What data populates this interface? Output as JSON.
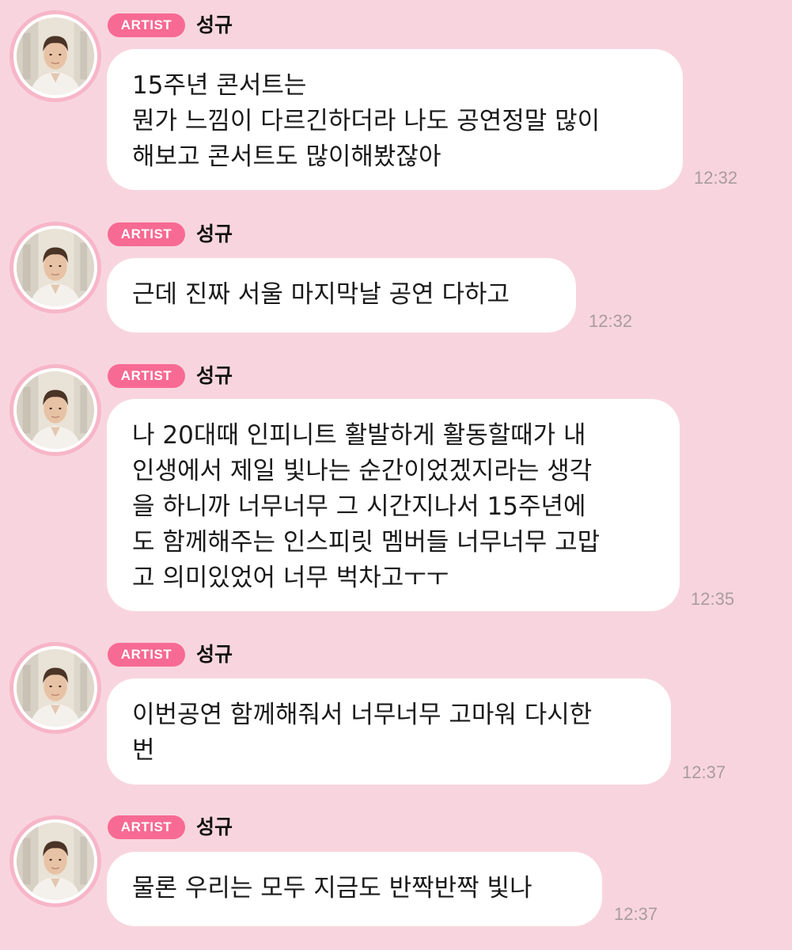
{
  "messages": [
    {
      "badge": "ARTIST",
      "sender": "성규",
      "text": "15주년 콘서트는\n뭔가 느낌이 다르긴하더라 나도 공연정말 많이\n해보고 콘서트도 많이해봤잖아",
      "time": "12:32"
    },
    {
      "badge": "ARTIST",
      "sender": "성규",
      "text": "근데 진짜 서울 마지막날 공연 다하고",
      "time": "12:32"
    },
    {
      "badge": "ARTIST",
      "sender": "성규",
      "text": "나 20대때 인피니트 활발하게 활동할때가 내\n인생에서 제일 빛나는 순간이었겠지라는 생각\n을 하니까 너무너무 그 시간지나서 15주년에\n도 함께해주는 인스피릿 멤버들 너무너무 고맙\n고 의미있었어 너무 벅차고ㅜㅜ",
      "time": "12:35"
    },
    {
      "badge": "ARTIST",
      "sender": "성규",
      "text": "이번공연 함께해줘서 너무너무 고마워 다시한\n번",
      "time": "12:37"
    },
    {
      "badge": "ARTIST",
      "sender": "성규",
      "text": "물론 우리는 모두 지금도 반짝반짝 빛나",
      "time": "12:37"
    }
  ],
  "colors": {
    "background": "#f8d5de",
    "badge": "#f76a93",
    "avatar_ring": "#f7b6c8",
    "bubble": "#ffffff",
    "time": "#a99ba0"
  },
  "icons": {
    "avatar": "profile-photo"
  }
}
